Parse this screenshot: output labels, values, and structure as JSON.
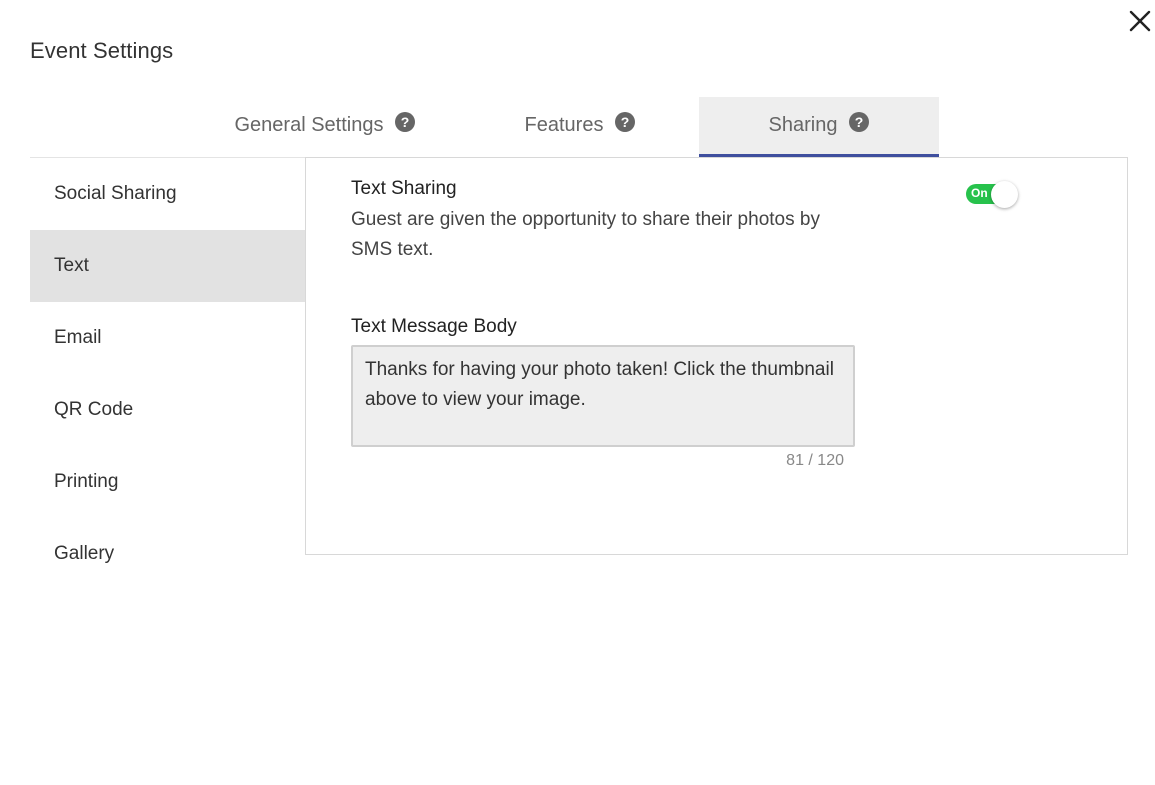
{
  "dialog": {
    "title": "Event Settings",
    "close_icon": "close-icon"
  },
  "tabs": [
    {
      "label": "General Settings",
      "icon": "help-icon",
      "active": false
    },
    {
      "label": "Features",
      "icon": "help-icon",
      "active": false
    },
    {
      "label": "Sharing",
      "icon": "help-icon",
      "active": true
    }
  ],
  "sidebar": {
    "items": [
      {
        "label": "Social Sharing",
        "active": false
      },
      {
        "label": "Text",
        "active": true
      },
      {
        "label": "Email",
        "active": false
      },
      {
        "label": "QR Code",
        "active": false
      },
      {
        "label": "Printing",
        "active": false
      },
      {
        "label": "Gallery",
        "active": false
      }
    ]
  },
  "text_sharing": {
    "title": "Text Sharing",
    "description": "Guest are given the opportunity to share their photos by SMS text.",
    "toggle_label": "On",
    "toggle_on": true
  },
  "message": {
    "label": "Text Message Body",
    "value": "Thanks for having your photo taken! Click the thumbnail above to view your image.",
    "counter": "81 / 120"
  },
  "colors": {
    "accent": "#3f4f9e",
    "toggle_on": "#27c24c",
    "active_tab_bg": "#eeeeee",
    "active_sidebar_bg": "#e2e2e2"
  }
}
